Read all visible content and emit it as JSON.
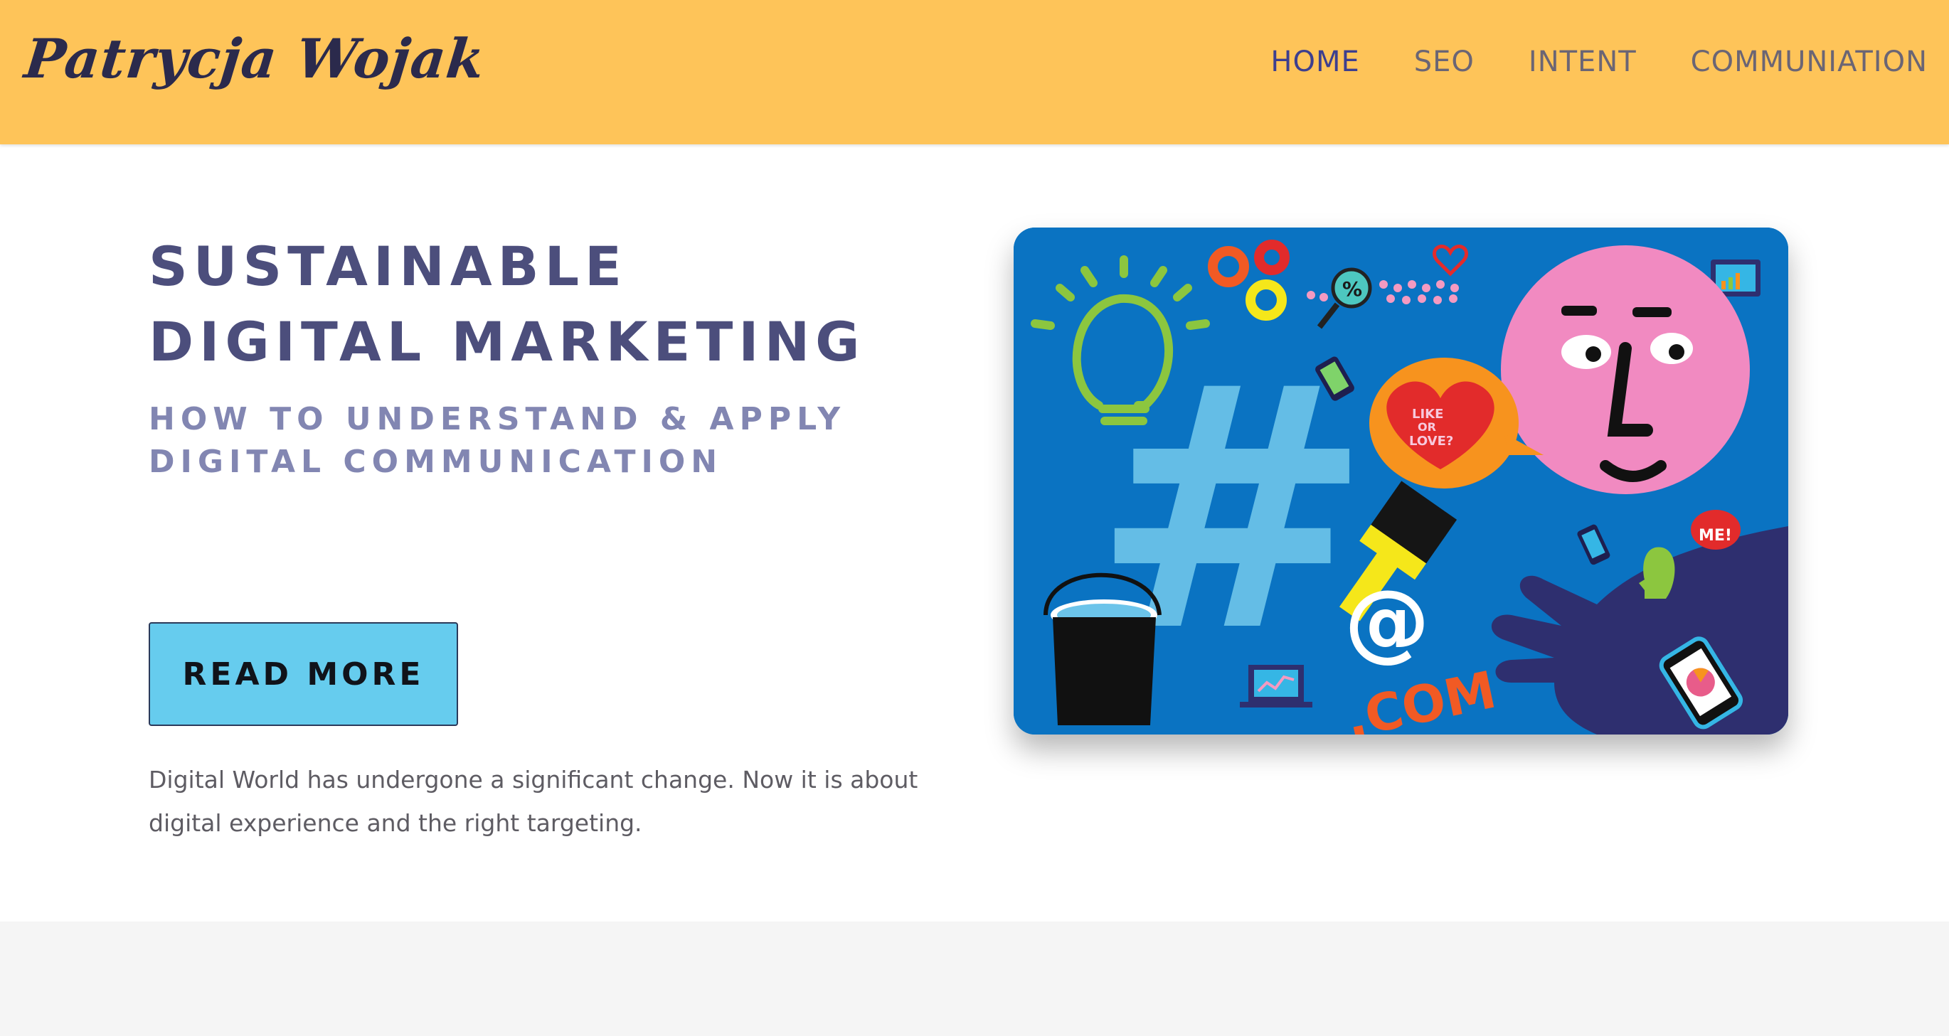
{
  "header": {
    "logo_text": "Patrycja Wojak",
    "nav": [
      {
        "label": "HOME",
        "active": true
      },
      {
        "label": "SEO",
        "active": false
      },
      {
        "label": "INTENT",
        "active": false
      },
      {
        "label": "COMMUNIATION",
        "active": false
      }
    ]
  },
  "hero": {
    "title_line1": "SUSTAINABLE",
    "title_line2": "DIGITAL MARKETING",
    "subtitle_line1": "HOW TO UNDERSTAND & APPLY",
    "subtitle_line2": "DIGITAL COMMUNICATION",
    "cta_label": "READ MORE",
    "description": "Digital World has undergone a significant change. Now it is about digital experience and the right targeting."
  },
  "illustration": {
    "hashtag_symbol": "#",
    "at_symbol": "@",
    "domain_text": ".COM",
    "heart_text_line1": "LIKE",
    "heart_text_line2": "OR",
    "heart_text_line3": "LOVE?",
    "me_text": "ME!",
    "percent_text": "%"
  },
  "colors": {
    "header_bg": "#fec459",
    "nav_active": "#3d3f8e",
    "nav_default": "#6b6574",
    "title": "#4c4e7c",
    "subtitle": "#8286b2",
    "button_bg": "#66ccee",
    "art_bg": "#0a73c2"
  }
}
